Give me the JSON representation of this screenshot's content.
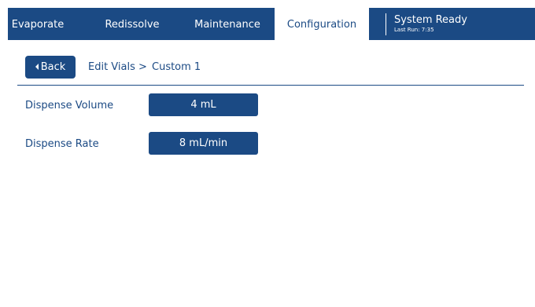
{
  "nav": {
    "tabs": [
      {
        "label": "Evaporate"
      },
      {
        "label": "Redissolve"
      },
      {
        "label": "Maintenance"
      },
      {
        "label": "Configuration"
      }
    ],
    "active_tab": "Configuration"
  },
  "status": {
    "title": "System Ready",
    "last_run": "Last Run: 7:35"
  },
  "breadcrumb": {
    "back_label": "Back",
    "parent": "Edit Vials >",
    "current": "Custom 1"
  },
  "settings": [
    {
      "label": "Dispense Volume",
      "value": "4 mL"
    },
    {
      "label": "Dispense Rate",
      "value": "8 mL/min"
    }
  ],
  "colors": {
    "primary": "#1b4a84",
    "background": "#ffffff"
  }
}
